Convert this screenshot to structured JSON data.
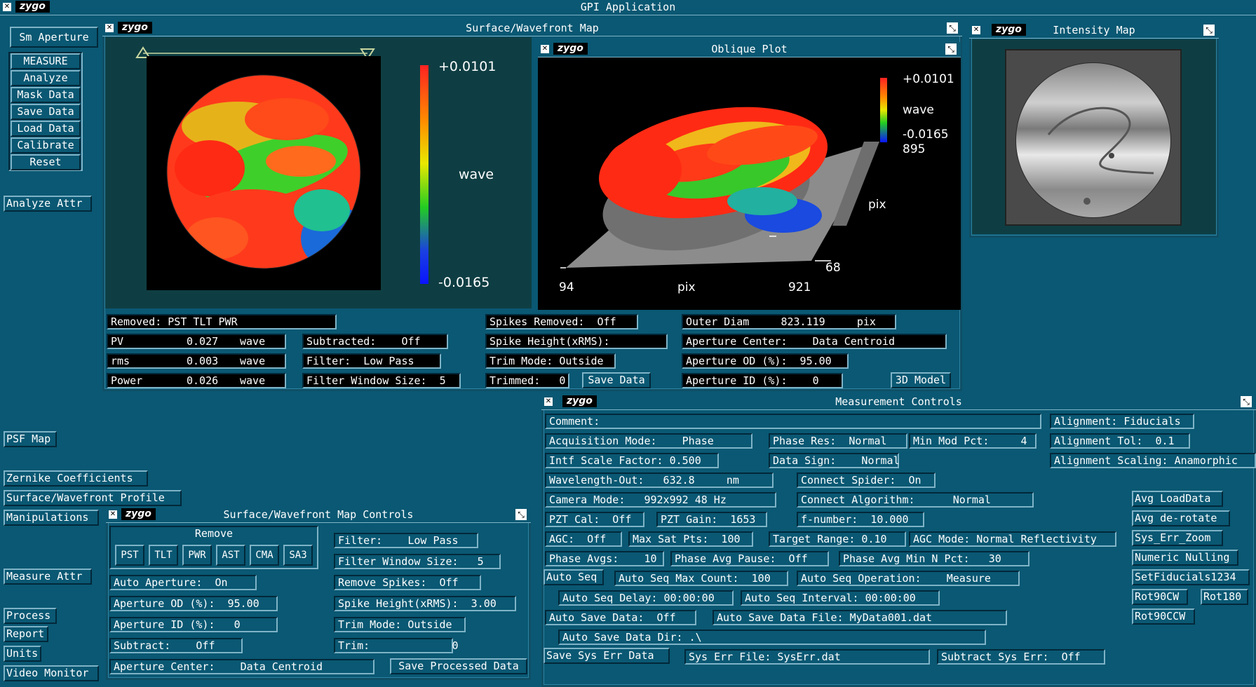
{
  "app": {
    "title": "GPI Application",
    "logo": "zygo"
  },
  "left_menu": {
    "aperture": "Sm Aperture",
    "buttons": [
      "MEASURE",
      "Analyze",
      "Mask Data",
      "Save Data",
      "Load Data",
      "Calibrate",
      "Reset"
    ],
    "analyze_attr": "Analyze Attr",
    "psf_map": "PSF Map",
    "zernike": "Zernike Coefficients",
    "surface_profile": "Surface/Wavefront Profile",
    "manipulations": "Manipulations",
    "measure_attr": "Measure Attr",
    "process": "Process",
    "report": "Report",
    "units": "Units",
    "video_monitor": "Video Monitor"
  },
  "surface_map": {
    "title": "Surface/Wavefront Map",
    "scale_max": "+0.0101",
    "scale_min": "-0.0165",
    "scale_unit": "wave"
  },
  "oblique_plot": {
    "title": "Oblique Plot",
    "scale_max": "+0.0101",
    "scale_unit": "wave",
    "scale_min": "-0.0165",
    "y_top": "895",
    "y_label": "pix",
    "y_bottom": "68",
    "x_left": "94",
    "x_label": "pix",
    "x_right": "921"
  },
  "intensity_map": {
    "title": "Intensity Map"
  },
  "results": {
    "removed": "Removed: PST TLT PWR",
    "pv": {
      "label": "PV",
      "value": "0.027",
      "unit": "wave"
    },
    "rms": {
      "label": "rms",
      "value": "0.003",
      "unit": "wave"
    },
    "power": {
      "label": "Power",
      "value": "0.026",
      "unit": "wave"
    },
    "subtracted": "Subtracted:    Off",
    "filter": "Filter:  Low Pass",
    "filter_window": "Filter Window Size:  5",
    "spikes_removed": "Spikes Removed:  Off",
    "spike_height": "Spike Height(xRMS):",
    "trim_mode": "Trim Mode: Outside",
    "trimmed": "Trimmed:   0",
    "save_data": "Save Data",
    "outer_diam": "Outer Diam     823.119     pix",
    "aperture_center": "Aperture Center:    Data Centroid",
    "aperture_od": "Aperture OD (%):  95.00",
    "aperture_id": "Aperture ID (%):    0",
    "model_3d": "3D Model"
  },
  "map_controls": {
    "title": "Surface/Wavefront Map Controls",
    "remove_label": "Remove",
    "remove_buttons": [
      "PST",
      "TLT",
      "PWR",
      "AST",
      "CMA",
      "SA3"
    ],
    "auto_aperture": "Auto Aperture:  On",
    "aperture_od": "Aperture OD (%):  95.00",
    "aperture_id": "Aperture ID (%):   0",
    "subtract": "Subtract:    Off",
    "aperture_center": "Aperture Center:    Data Centroid",
    "filter": "Filter:    Low Pass",
    "filter_window": "Filter Window Size:   5",
    "remove_spikes": "Remove Spikes:  Off",
    "spike_height": "Spike Height(xRMS):  3.00",
    "trim_mode": "Trim Mode: Outside",
    "trim": "Trim:             0",
    "save_processed": "Save Processed Data"
  },
  "measurement_controls": {
    "title": "Measurement Controls",
    "comment": "Comment:",
    "alignment": "Alignment: Fiducials",
    "acq_mode": "Acquisition Mode:    Phase",
    "phase_res": "Phase Res:  Normal",
    "min_mod": "Min Mod Pct:     4",
    "alignment_tol": "Alignment Tol:  0.1",
    "intf_scale": "Intf Scale Factor: 0.500",
    "data_sign": "Data Sign:    Normal",
    "alignment_scaling": "Alignment Scaling: Anamorphic",
    "wavelength": "Wavelength-Out:   632.8     nm",
    "connect_spider": "Connect Spider:  On",
    "camera_mode": "Camera Mode:   992x992 48 Hz",
    "connect_algo": "Connect Algorithm:      Normal",
    "pzt_cal": "PZT Cal:  Off",
    "pzt_gain": "PZT Gain:  1653",
    "f_number": "f-number:  10.000",
    "agc": "AGC:  Off",
    "max_sat": "Max Sat Pts:  100",
    "target_range": "Target Range: 0.10",
    "agc_mode": "AGC Mode: Normal Reflectivity",
    "phase_avgs": "Phase Avgs:    10",
    "phase_avg_pause": "Phase Avg Pause:  Off",
    "phase_avg_min": "Phase Avg Min N Pct:   30",
    "auto_seq": "Auto Seq",
    "auto_seq_max": "Auto Seq Max Count:  100",
    "auto_seq_op": "Auto Seq Operation:    Measure",
    "auto_seq_delay": "Auto Seq Delay: 00:00:00",
    "auto_seq_interval": "Auto Seq Interval: 00:00:00",
    "auto_save": "Auto Save Data:  Off",
    "auto_save_file": "Auto Save Data File: MyData001.dat",
    "auto_save_dir": "Auto Save Data Dir: .\\",
    "save_sys_err": "Save Sys Err Data",
    "sys_err_file": "Sys Err File: SysErr.dat",
    "subtract_sys_err": "Subtract Sys Err:  Off",
    "side_buttons": {
      "avg_load": "Avg LoadData",
      "avg_derotate": "Avg de-rotate",
      "sys_err_zoom": "Sys_Err_Zoom",
      "numeric_nulling": "Numeric Nulling",
      "set_fiducials": "SetFiducials1234",
      "rot90cw": "Rot90CW",
      "rot180": "Rot180",
      "rot90ccw": "Rot90CCW"
    }
  },
  "colors": {
    "background": "#0a5873",
    "plot_bg": "#000000",
    "panel_dark": "#0e3e43"
  }
}
